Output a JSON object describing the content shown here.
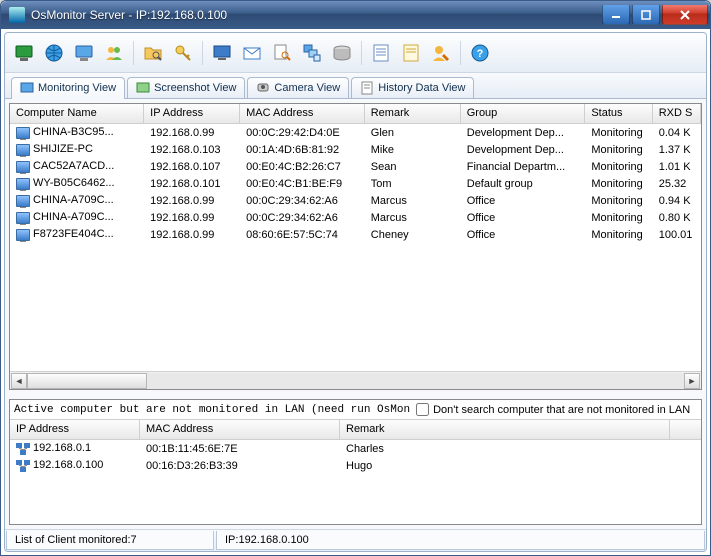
{
  "titlebar": {
    "text": "OsMonitor Server -   IP:192.168.0.100"
  },
  "tabs": [
    {
      "label": "Monitoring View",
      "active": true
    },
    {
      "label": "Screenshot View",
      "active": false
    },
    {
      "label": "Camera View",
      "active": false
    },
    {
      "label": "History Data View",
      "active": false
    }
  ],
  "toolbar_icons": [
    "monitor-green-icon",
    "globe-icon",
    "display-icon",
    "users-icon",
    "sep",
    "folder-search-icon",
    "key-icon",
    "sep",
    "screen-icon",
    "mail-icon",
    "page-search-icon",
    "windows-icon",
    "disk-icon",
    "sep",
    "form-icon",
    "note-icon",
    "user-edit-icon",
    "sep",
    "help-icon"
  ],
  "grid": {
    "columns": [
      "Computer Name",
      "IP Address",
      "MAC Address",
      "Remark",
      "Group",
      "Status",
      "RXD S"
    ],
    "rows": [
      {
        "name": "CHINA-B3C95...",
        "ip": "192.168.0.99",
        "mac": "00:0C:29:42:D4:0E",
        "remark": "Glen",
        "group": "Development Dep...",
        "status": "Monitoring",
        "rxd": "0.04 K"
      },
      {
        "name": "SHIJIZE-PC",
        "ip": "192.168.0.103",
        "mac": "00:1A:4D:6B:81:92",
        "remark": "Mike",
        "group": "Development Dep...",
        "status": "Monitoring",
        "rxd": "1.37 K"
      },
      {
        "name": "CAC52A7ACD...",
        "ip": "192.168.0.107",
        "mac": "00:E0:4C:B2:26:C7",
        "remark": "Sean",
        "group": "Financial Departm...",
        "status": "Monitoring",
        "rxd": "1.01 K"
      },
      {
        "name": "WY-B05C6462...",
        "ip": "192.168.0.101",
        "mac": "00:E0:4C:B1:BE:F9",
        "remark": "Tom",
        "group": "Default group",
        "status": "Monitoring",
        "rxd": "25.32"
      },
      {
        "name": "CHINA-A709C...",
        "ip": "192.168.0.99",
        "mac": "00:0C:29:34:62:A6",
        "remark": "Marcus",
        "group": "Office",
        "status": "Monitoring",
        "rxd": "0.94 K"
      },
      {
        "name": "CHINA-A709C...",
        "ip": "192.168.0.99",
        "mac": "00:0C:29:34:62:A6",
        "remark": "Marcus",
        "group": "Office",
        "status": "Monitoring",
        "rxd": "0.80 K"
      },
      {
        "name": "F8723FE404C...",
        "ip": "192.168.0.99",
        "mac": "08:60:6E:57:5C:74",
        "remark": "Cheney",
        "group": "Office",
        "status": "Monitoring",
        "rxd": "100.01"
      }
    ]
  },
  "bottom": {
    "message": "Active computer but are not monitored in LAN (need run OsMon",
    "checkbox_label": "Don't search computer that are not monitored in LAN",
    "columns": [
      "IP Address",
      "MAC Address",
      "Remark"
    ],
    "rows": [
      {
        "ip": "192.168.0.1",
        "mac": "00:1B:11:45:6E:7E",
        "remark": "Charles"
      },
      {
        "ip": "192.168.0.100",
        "mac": "00:16:D3:26:B3:39",
        "remark": "Hugo"
      }
    ]
  },
  "statusbar": {
    "clients": "List of Client monitored:7",
    "ip": "IP:192.168.0.100"
  }
}
